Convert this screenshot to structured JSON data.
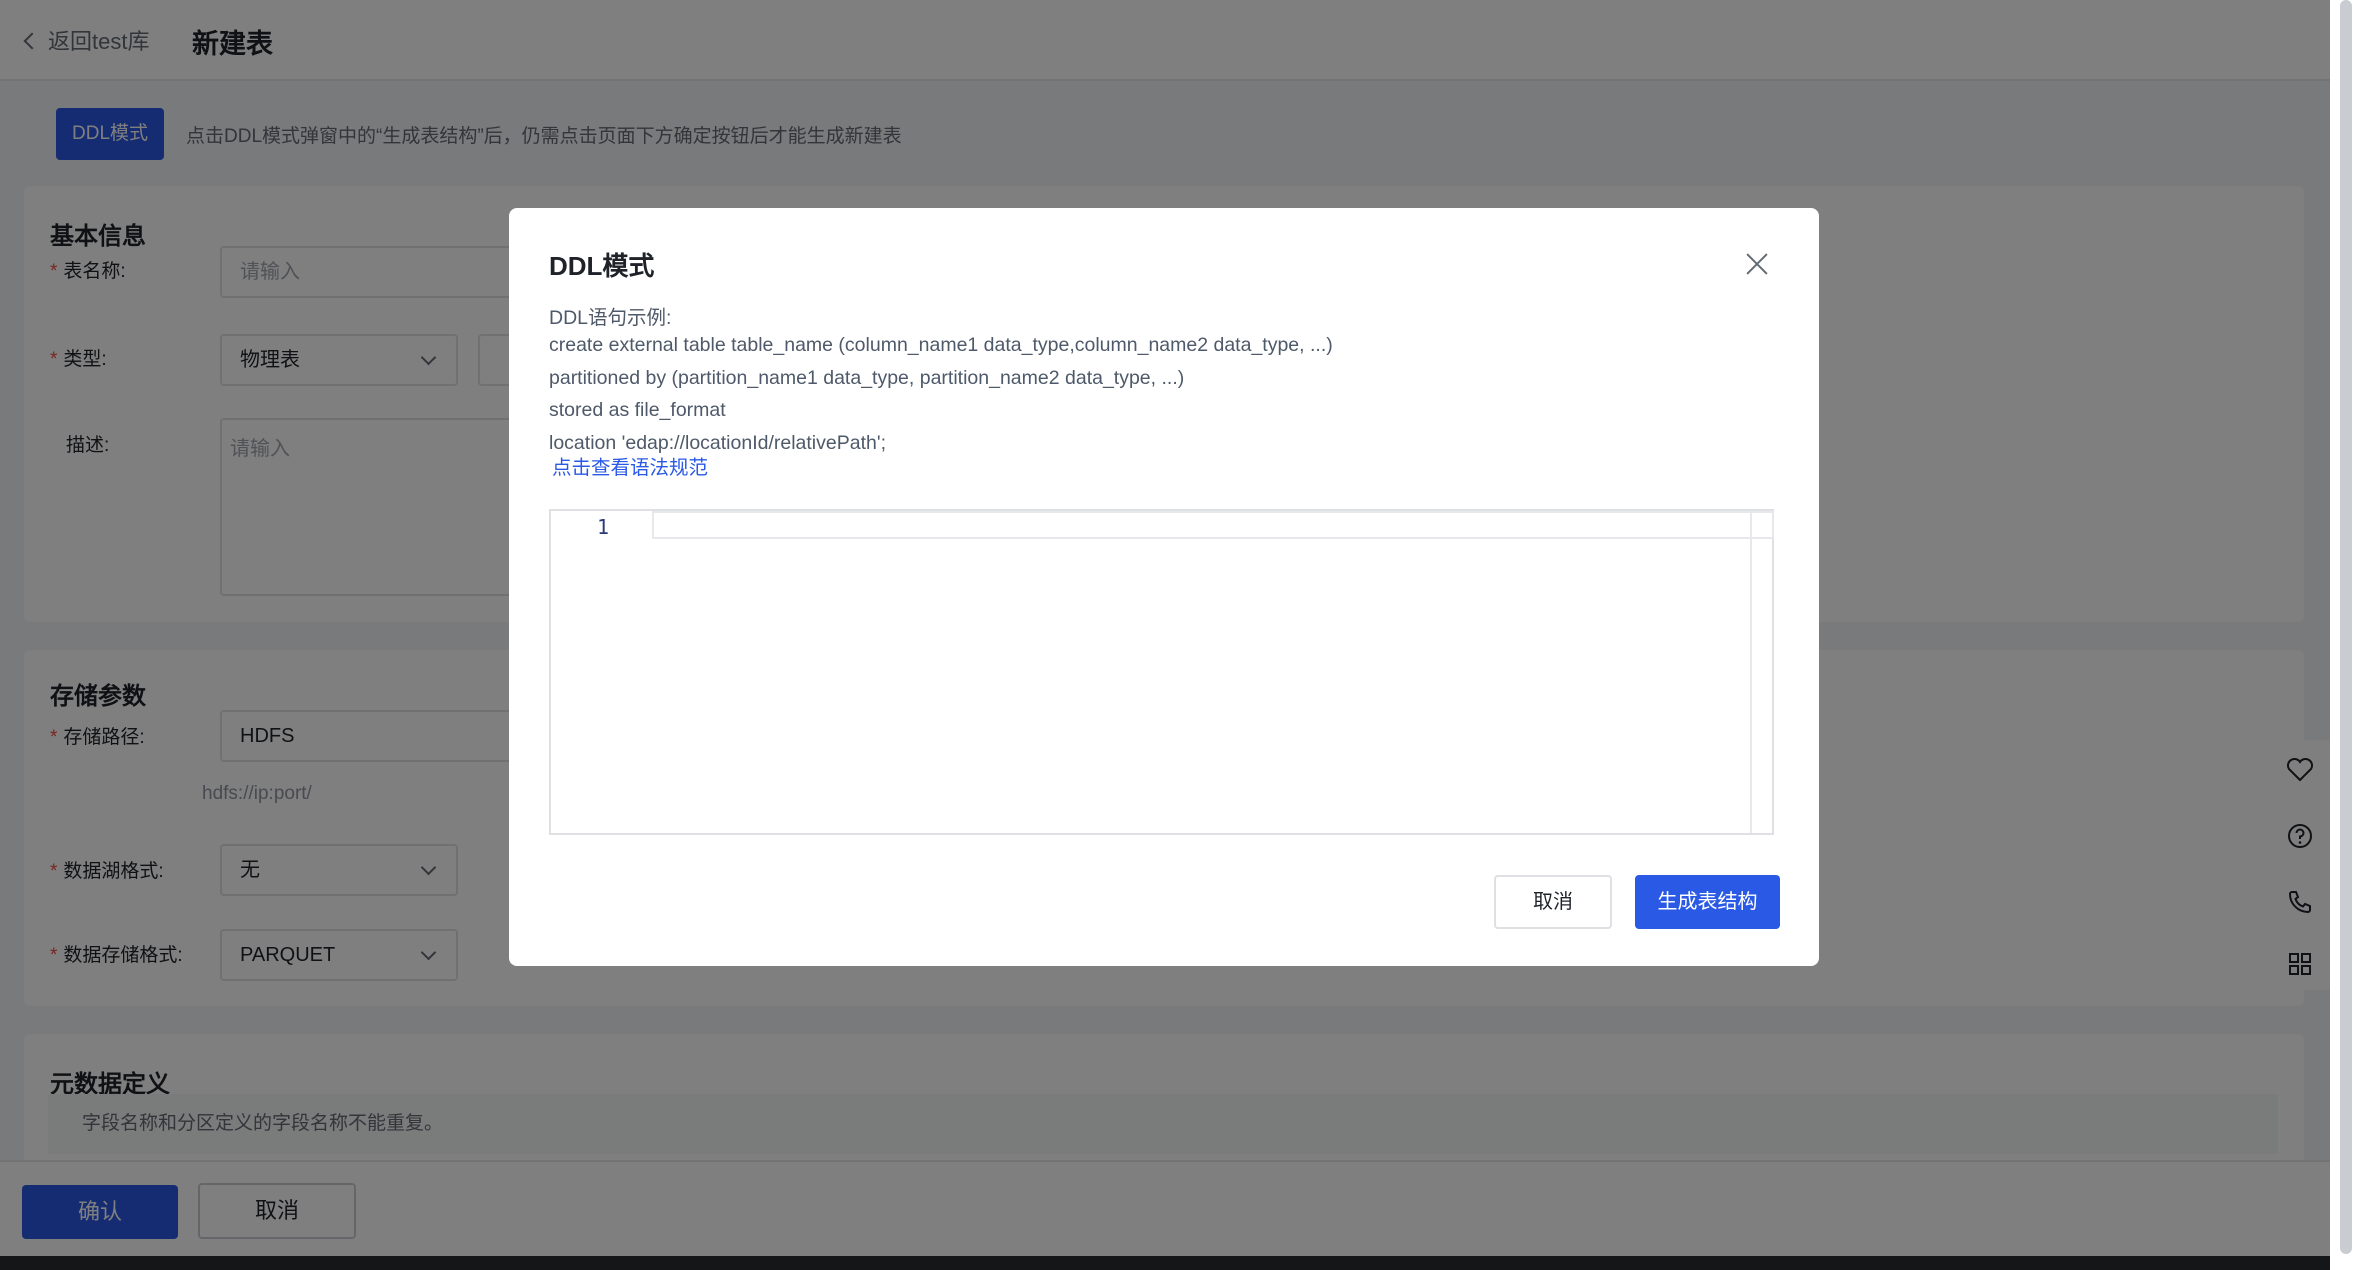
{
  "header": {
    "back_label": "返回test库",
    "title": "新建表"
  },
  "mode": {
    "button_label": "DDL模式",
    "tip": "点击DDL模式弹窗中的“生成表结构”后，仍需点击页面下方确定按钮后才能生成新建表"
  },
  "basic_info": {
    "heading": "基本信息",
    "table_name_label": "表名称:",
    "table_name_placeholder": "请输入",
    "type_label": "类型:",
    "type_value": "物理表",
    "desc_label": "描述:",
    "desc_placeholder": "请输入"
  },
  "storage": {
    "heading": "存储参数",
    "path_label": "存储路径:",
    "path_value": "HDFS",
    "path_hint": "hdfs://ip:port/",
    "lake_format_label": "数据湖格式:",
    "lake_format_value": "无",
    "storage_format_label": "数据存储格式:",
    "storage_format_value": "PARQUET"
  },
  "metadata": {
    "heading": "元数据定义",
    "notice": "字段名称和分区定义的字段名称不能重复。"
  },
  "footer": {
    "confirm_label": "确认",
    "cancel_label": "取消"
  },
  "modal": {
    "title": "DDL模式",
    "example_heading": "DDL语句示例:",
    "lines": [
      "create external table table_name (column_name1 data_type,column_name2 data_type, ...)",
      "partitioned by (partition_name1 data_type, partition_name2 data_type, ...)",
      "stored as file_format",
      "location 'edap://locationId/relativePath';"
    ],
    "syntax_link": "点击查看语法规范",
    "editor": {
      "line_number": "1",
      "content": ""
    },
    "cancel_label": "取消",
    "generate_label": "生成表结构"
  },
  "side_tools": [
    "heart-icon",
    "help-icon",
    "phone-icon",
    "grid-icon"
  ],
  "colors": {
    "primary": "#2a59e6",
    "required": "#f54a45",
    "mask": "rgba(0,0,0,0.5)"
  }
}
